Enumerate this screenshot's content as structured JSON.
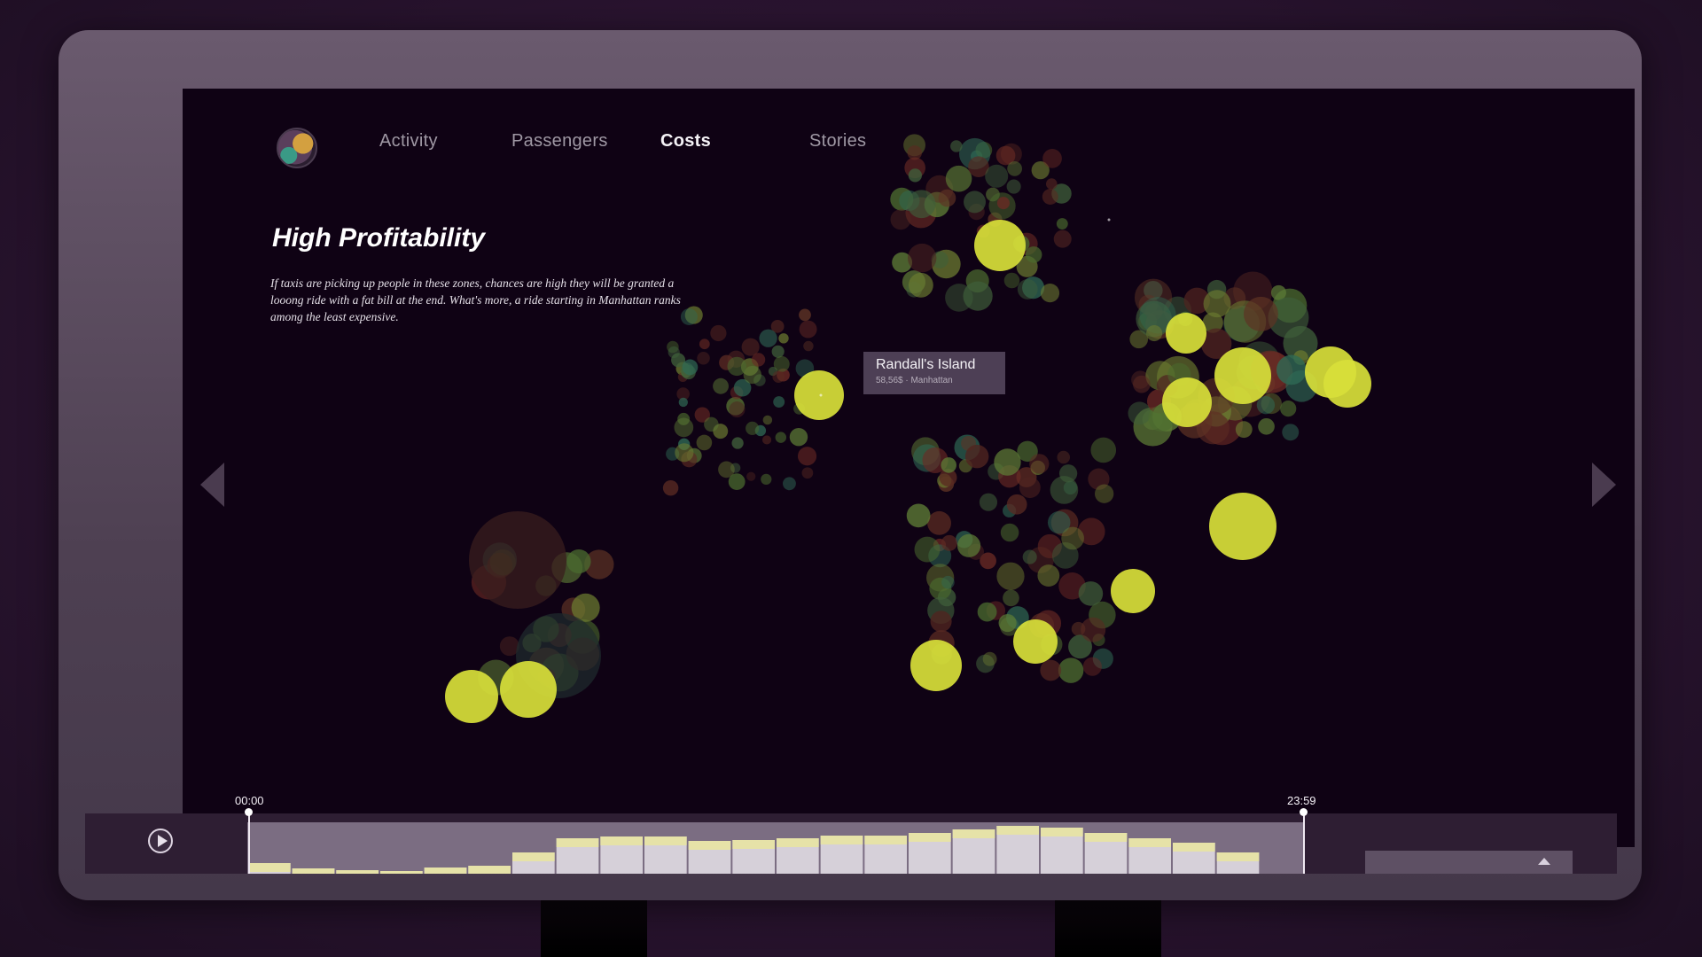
{
  "nav": {
    "items": [
      {
        "label": "Activity"
      },
      {
        "label": "Passengers"
      },
      {
        "label": "Costs",
        "active": true
      },
      {
        "label": "Stories"
      }
    ]
  },
  "story": {
    "title": "High Profitability",
    "description": "If taxis are picking up people in these zones, chances are high they will be granted a looong ride with a fat bill at the end. What's more, a ride starting in Manhattan ranks among the least expensive."
  },
  "tooltip": {
    "name": "Randall's Island",
    "detail": "58,56$ · Manhattan"
  },
  "timeline": {
    "start_label": "00:00",
    "end_label": "23:59"
  },
  "colors": {
    "background": "#0f0214",
    "highlight": "#d8e03a",
    "cluster_green": "#5d7c36",
    "cluster_red": "#6b2b24",
    "histogram_bar": "#d6d0d9",
    "histogram_cap": "#e6e2a8"
  },
  "icons": {
    "logo": "bubble-logo-icon",
    "prev": "chevron-left-icon",
    "next": "chevron-right-icon",
    "play": "play-icon",
    "panel": "chevron-up-icon"
  }
}
